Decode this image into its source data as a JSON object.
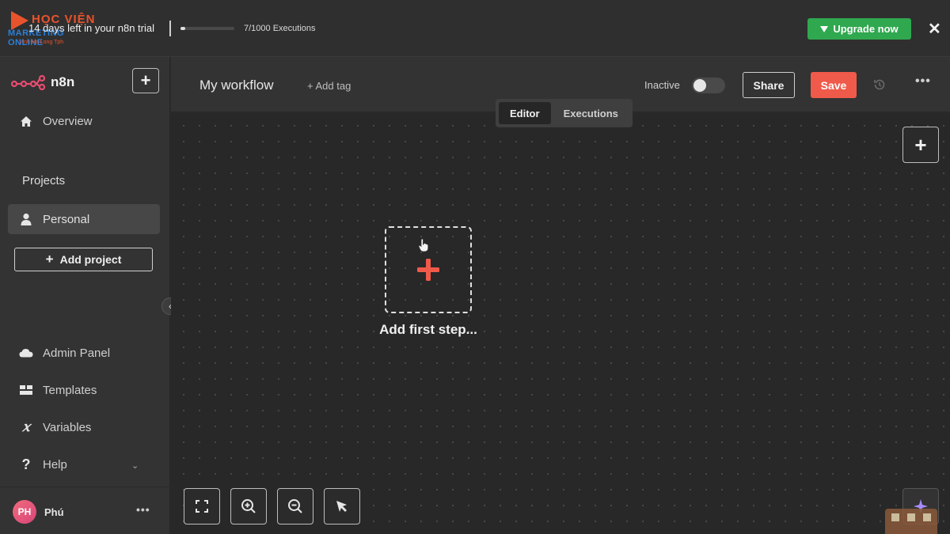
{
  "banner": {
    "brand_line1": "HỌC VIỆN",
    "brand_line2": "MARKETING ONLINE",
    "brand_line3": "Vinh Ha Long Tph",
    "trial_text": "14 days left in your n8n trial",
    "executions_label": "7/1000 Executions",
    "executions_used_fraction": 0.007,
    "upgrade_label": "Upgrade now",
    "upgrade_icon": "gem-icon",
    "close_label": "✕",
    "upgrade_color": "#2fa84f"
  },
  "sidebar": {
    "logo_text": "n8n",
    "logo_color": "#ea4b71",
    "add_label": "+",
    "nav_top": [
      {
        "label": "Overview",
        "icon": "home-icon"
      }
    ],
    "projects_title": "Projects",
    "projects": [
      {
        "label": "Personal",
        "icon": "user-icon",
        "active": true
      }
    ],
    "add_project_label": "Add project",
    "nav_bottom": [
      {
        "label": "Admin Panel",
        "icon": "cloud-icon"
      },
      {
        "label": "Templates",
        "icon": "templates-icon"
      },
      {
        "label": "Variables",
        "icon": "variables-icon"
      },
      {
        "label": "Help",
        "icon": "help-icon"
      }
    ],
    "collapse_label": "‹",
    "user": {
      "initials": "PH",
      "name": "Phú",
      "menu_label": "•••"
    }
  },
  "header": {
    "workflow_name": "My workflow",
    "add_tag_label": "+ Add tag",
    "status_label": "Inactive",
    "share_label": "Share",
    "save_label": "Save",
    "save_color": "#f05a4a",
    "more_label": "•••"
  },
  "canvas": {
    "tabs": [
      {
        "label": "Editor",
        "active": true
      },
      {
        "label": "Executions",
        "active": false
      }
    ],
    "add_node_label": "+",
    "first_step_label": "Add first step...",
    "first_step_color": "#f05a4a",
    "controls": [
      "fit-view-icon",
      "zoom-in-icon",
      "zoom-out-icon",
      "tidy-up-icon"
    ]
  }
}
